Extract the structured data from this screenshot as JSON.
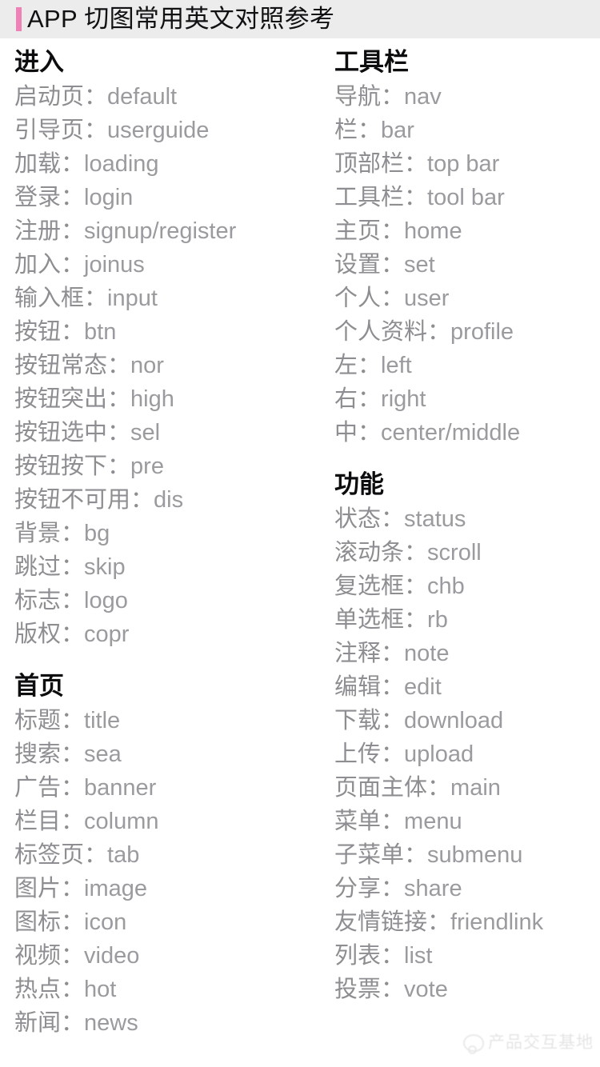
{
  "header": {
    "title": "APP 切图常用英文对照参考",
    "accent_color": "#ee82b6",
    "background_color": "#ececed"
  },
  "separator": "：",
  "columns": {
    "left": [
      {
        "title": "进入",
        "entries": [
          {
            "zh": "启动页",
            "en": "default"
          },
          {
            "zh": "引导页",
            "en": "userguide"
          },
          {
            "zh": "加载",
            "en": "loading"
          },
          {
            "zh": "登录",
            "en": "login"
          },
          {
            "zh": "注册",
            "en": "signup/register"
          },
          {
            "zh": "加入",
            "en": "joinus"
          },
          {
            "zh": "输入框",
            "en": "input"
          },
          {
            "zh": "按钮",
            "en": "btn"
          },
          {
            "zh": "按钮常态",
            "en": "nor"
          },
          {
            "zh": "按钮突出",
            "en": "high"
          },
          {
            "zh": "按钮选中",
            "en": "sel"
          },
          {
            "zh": "按钮按下",
            "en": "pre"
          },
          {
            "zh": "按钮不可用",
            "en": "dis"
          },
          {
            "zh": "背景",
            "en": "bg"
          },
          {
            "zh": "跳过",
            "en": "skip"
          },
          {
            "zh": "标志",
            "en": "logo"
          },
          {
            "zh": "版权",
            "en": "copr"
          }
        ]
      },
      {
        "title": "首页",
        "entries": [
          {
            "zh": "标题",
            "en": "title"
          },
          {
            "zh": "搜索",
            "en": "sea"
          },
          {
            "zh": "广告",
            "en": "banner"
          },
          {
            "zh": "栏目",
            "en": "column"
          },
          {
            "zh": "标签页",
            "en": "tab"
          },
          {
            "zh": "图片",
            "en": "image"
          },
          {
            "zh": "图标",
            "en": "icon"
          },
          {
            "zh": "视频",
            "en": "video"
          },
          {
            "zh": "热点",
            "en": "hot"
          },
          {
            "zh": "新闻",
            "en": "news"
          }
        ]
      }
    ],
    "right": [
      {
        "title": "工具栏",
        "entries": [
          {
            "zh": "导航",
            "en": "nav"
          },
          {
            "zh": "栏",
            "en": "bar"
          },
          {
            "zh": "顶部栏",
            "en": "top bar"
          },
          {
            "zh": "工具栏",
            "en": "tool bar"
          },
          {
            "zh": "主页",
            "en": "home"
          },
          {
            "zh": "设置",
            "en": "set"
          },
          {
            "zh": "个人",
            "en": "user"
          },
          {
            "zh": "个人资料",
            "en": "profile"
          },
          {
            "zh": "左",
            "en": "left"
          },
          {
            "zh": "右",
            "en": "right"
          },
          {
            "zh": "中",
            "en": "center/middle"
          }
        ]
      },
      {
        "title": "功能",
        "entries": [
          {
            "zh": "状态",
            "en": "status"
          },
          {
            "zh": "滚动条",
            "en": "scroll"
          },
          {
            "zh": "复选框",
            "en": "chb"
          },
          {
            "zh": "单选框",
            "en": "rb"
          },
          {
            "zh": "注释",
            "en": "note"
          },
          {
            "zh": "编辑",
            "en": "edit"
          },
          {
            "zh": "下载",
            "en": "download"
          },
          {
            "zh": "上传",
            "en": "upload"
          },
          {
            "zh": "页面主体",
            "en": "main"
          },
          {
            "zh": "菜单",
            "en": "menu"
          },
          {
            "zh": "子菜单",
            "en": "submenu"
          },
          {
            "zh": "分享",
            "en": "share"
          },
          {
            "zh": "友情链接",
            "en": "friendlink"
          },
          {
            "zh": "列表",
            "en": "list"
          },
          {
            "zh": "投票",
            "en": "vote"
          }
        ]
      }
    ]
  },
  "watermark": {
    "text": "产品交互基地"
  }
}
